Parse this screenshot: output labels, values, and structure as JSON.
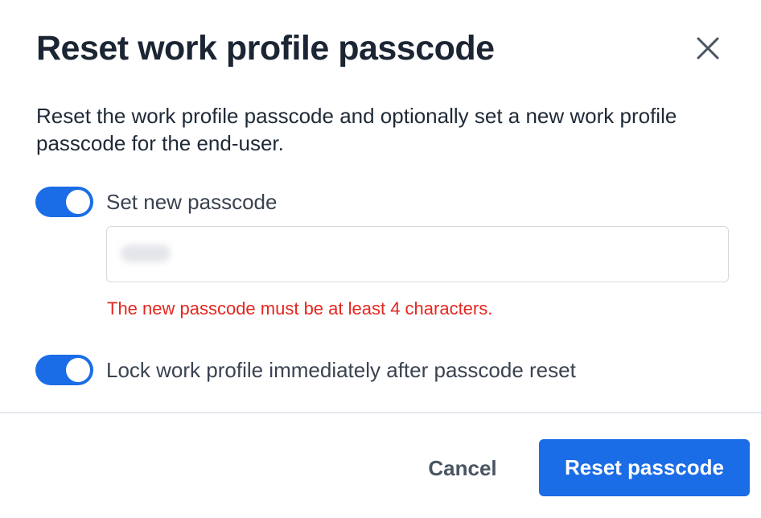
{
  "dialog": {
    "title": "Reset work profile passcode",
    "close_icon": "close-icon",
    "description": "Reset the work profile passcode and optionally set a new work profile passcode for the end-user."
  },
  "set_passcode": {
    "toggle_on": true,
    "label": "Set new passcode",
    "input_value": "",
    "error": "The new passcode must be at least 4 characters."
  },
  "lock_profile": {
    "toggle_on": true,
    "label": "Lock work profile immediately after passcode reset"
  },
  "footer": {
    "cancel_label": "Cancel",
    "submit_label": "Reset passcode"
  },
  "colors": {
    "accent": "#1a6de6",
    "error": "#e5261f",
    "title": "#1b2533",
    "text": "#1f2a37"
  }
}
